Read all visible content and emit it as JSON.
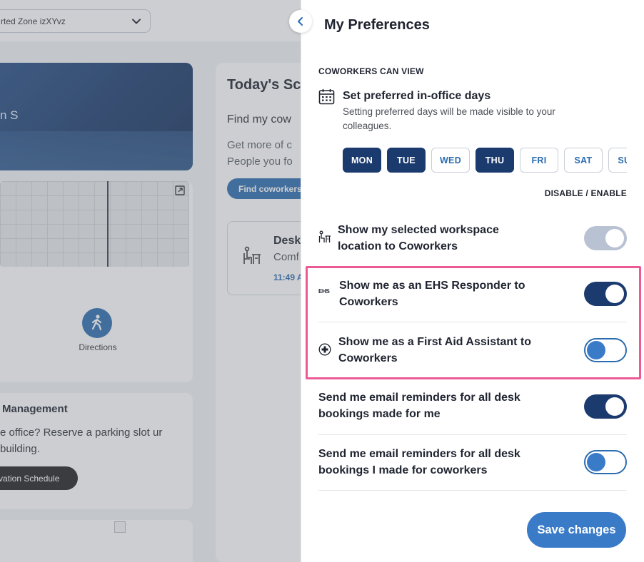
{
  "background": {
    "zone_select": {
      "value": "rted Zone izXYvz",
      "icon": "chevron-down-icon"
    },
    "hero": {
      "text": "n S"
    },
    "directions": {
      "label": "Directions",
      "icon": "walking-person-icon"
    },
    "parking": {
      "title": "Management",
      "description": "e office? Reserve a parking slot ur building.",
      "button": "rvation Schedule"
    },
    "schedule": {
      "title": "Today's Sch",
      "find": "Find my cow",
      "more_line1": "Get more of c",
      "more_line2": "People you fo",
      "find_button": "Find coworkers",
      "desk": {
        "title": "Desk",
        "subtitle": "Comf",
        "time": "11:49 A",
        "icon": "desk-chair-icon"
      }
    }
  },
  "panel": {
    "title": "My Preferences",
    "collapse_icon": "chevron-left-icon",
    "section_label": "COWORKERS CAN VIEW",
    "preferred_days": {
      "icon": "calendar-icon",
      "title": "Set preferred in-office days",
      "description": "Setting preferred days will be made visible to your colleagues.",
      "days": [
        {
          "label": "MON",
          "selected": true
        },
        {
          "label": "TUE",
          "selected": true
        },
        {
          "label": "WED",
          "selected": false
        },
        {
          "label": "THU",
          "selected": true
        },
        {
          "label": "FRI",
          "selected": false
        },
        {
          "label": "SAT",
          "selected": false
        },
        {
          "label": "SUN",
          "selected": false
        }
      ]
    },
    "toggle_header": "DISABLE / ENABLE",
    "settings": [
      {
        "icon": "workspace-location-icon",
        "label": "Show my selected workspace location to Coworkers",
        "state": "on-disabled"
      },
      {
        "icon": "ehs-icon",
        "icon_text": "EHS",
        "label": "Show me as an EHS Responder to Coworkers",
        "state": "on"
      },
      {
        "icon": "first-aid-icon",
        "label": "Show me as a First Aid Assistant to Coworkers",
        "state": "off"
      },
      {
        "icon": "",
        "label": "Send me email reminders for all desk bookings made for me",
        "state": "on"
      },
      {
        "icon": "",
        "label": "Send me email reminders for all desk bookings I made for coworkers",
        "state": "off"
      }
    ],
    "save_button": "Save changes",
    "colors": {
      "primary_dark": "#1b3b6f",
      "primary": "#3a7bc8",
      "highlight": "#ec5a96"
    }
  }
}
